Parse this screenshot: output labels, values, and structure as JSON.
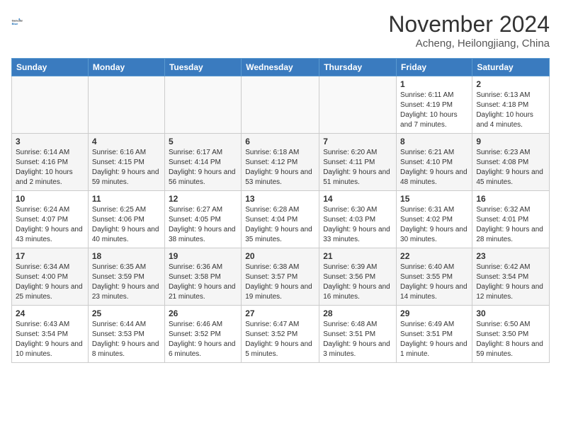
{
  "header": {
    "logo": {
      "general": "General",
      "blue": "Blue"
    },
    "title": "November 2024",
    "location": "Acheng, Heilongjiang, China"
  },
  "days_of_week": [
    "Sunday",
    "Monday",
    "Tuesday",
    "Wednesday",
    "Thursday",
    "Friday",
    "Saturday"
  ],
  "weeks": [
    [
      {
        "day": "",
        "data": ""
      },
      {
        "day": "",
        "data": ""
      },
      {
        "day": "",
        "data": ""
      },
      {
        "day": "",
        "data": ""
      },
      {
        "day": "",
        "data": ""
      },
      {
        "day": "1",
        "data": "Sunrise: 6:11 AM\nSunset: 4:19 PM\nDaylight: 10 hours and 7 minutes."
      },
      {
        "day": "2",
        "data": "Sunrise: 6:13 AM\nSunset: 4:18 PM\nDaylight: 10 hours and 4 minutes."
      }
    ],
    [
      {
        "day": "3",
        "data": "Sunrise: 6:14 AM\nSunset: 4:16 PM\nDaylight: 10 hours and 2 minutes."
      },
      {
        "day": "4",
        "data": "Sunrise: 6:16 AM\nSunset: 4:15 PM\nDaylight: 9 hours and 59 minutes."
      },
      {
        "day": "5",
        "data": "Sunrise: 6:17 AM\nSunset: 4:14 PM\nDaylight: 9 hours and 56 minutes."
      },
      {
        "day": "6",
        "data": "Sunrise: 6:18 AM\nSunset: 4:12 PM\nDaylight: 9 hours and 53 minutes."
      },
      {
        "day": "7",
        "data": "Sunrise: 6:20 AM\nSunset: 4:11 PM\nDaylight: 9 hours and 51 minutes."
      },
      {
        "day": "8",
        "data": "Sunrise: 6:21 AM\nSunset: 4:10 PM\nDaylight: 9 hours and 48 minutes."
      },
      {
        "day": "9",
        "data": "Sunrise: 6:23 AM\nSunset: 4:08 PM\nDaylight: 9 hours and 45 minutes."
      }
    ],
    [
      {
        "day": "10",
        "data": "Sunrise: 6:24 AM\nSunset: 4:07 PM\nDaylight: 9 hours and 43 minutes."
      },
      {
        "day": "11",
        "data": "Sunrise: 6:25 AM\nSunset: 4:06 PM\nDaylight: 9 hours and 40 minutes."
      },
      {
        "day": "12",
        "data": "Sunrise: 6:27 AM\nSunset: 4:05 PM\nDaylight: 9 hours and 38 minutes."
      },
      {
        "day": "13",
        "data": "Sunrise: 6:28 AM\nSunset: 4:04 PM\nDaylight: 9 hours and 35 minutes."
      },
      {
        "day": "14",
        "data": "Sunrise: 6:30 AM\nSunset: 4:03 PM\nDaylight: 9 hours and 33 minutes."
      },
      {
        "day": "15",
        "data": "Sunrise: 6:31 AM\nSunset: 4:02 PM\nDaylight: 9 hours and 30 minutes."
      },
      {
        "day": "16",
        "data": "Sunrise: 6:32 AM\nSunset: 4:01 PM\nDaylight: 9 hours and 28 minutes."
      }
    ],
    [
      {
        "day": "17",
        "data": "Sunrise: 6:34 AM\nSunset: 4:00 PM\nDaylight: 9 hours and 25 minutes."
      },
      {
        "day": "18",
        "data": "Sunrise: 6:35 AM\nSunset: 3:59 PM\nDaylight: 9 hours and 23 minutes."
      },
      {
        "day": "19",
        "data": "Sunrise: 6:36 AM\nSunset: 3:58 PM\nDaylight: 9 hours and 21 minutes."
      },
      {
        "day": "20",
        "data": "Sunrise: 6:38 AM\nSunset: 3:57 PM\nDaylight: 9 hours and 19 minutes."
      },
      {
        "day": "21",
        "data": "Sunrise: 6:39 AM\nSunset: 3:56 PM\nDaylight: 9 hours and 16 minutes."
      },
      {
        "day": "22",
        "data": "Sunrise: 6:40 AM\nSunset: 3:55 PM\nDaylight: 9 hours and 14 minutes."
      },
      {
        "day": "23",
        "data": "Sunrise: 6:42 AM\nSunset: 3:54 PM\nDaylight: 9 hours and 12 minutes."
      }
    ],
    [
      {
        "day": "24",
        "data": "Sunrise: 6:43 AM\nSunset: 3:54 PM\nDaylight: 9 hours and 10 minutes."
      },
      {
        "day": "25",
        "data": "Sunrise: 6:44 AM\nSunset: 3:53 PM\nDaylight: 9 hours and 8 minutes."
      },
      {
        "day": "26",
        "data": "Sunrise: 6:46 AM\nSunset: 3:52 PM\nDaylight: 9 hours and 6 minutes."
      },
      {
        "day": "27",
        "data": "Sunrise: 6:47 AM\nSunset: 3:52 PM\nDaylight: 9 hours and 5 minutes."
      },
      {
        "day": "28",
        "data": "Sunrise: 6:48 AM\nSunset: 3:51 PM\nDaylight: 9 hours and 3 minutes."
      },
      {
        "day": "29",
        "data": "Sunrise: 6:49 AM\nSunset: 3:51 PM\nDaylight: 9 hours and 1 minute."
      },
      {
        "day": "30",
        "data": "Sunrise: 6:50 AM\nSunset: 3:50 PM\nDaylight: 8 hours and 59 minutes."
      }
    ]
  ]
}
